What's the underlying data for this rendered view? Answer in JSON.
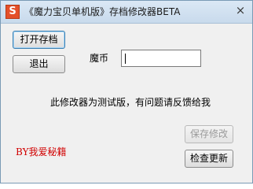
{
  "window": {
    "title": "《魔力宝贝单机版》存档修改器BETA",
    "icon_letter": "S",
    "close_glyph": "×"
  },
  "buttons": {
    "open_save": "打开存档",
    "exit": "退出",
    "save_changes": "保存修改",
    "check_update": "检查更新"
  },
  "form": {
    "coin_label": "魔币",
    "coin_value": ""
  },
  "info_text": "此修改器为测试版，有问题请反馈给我",
  "credit_text": "BY我爱秘籍",
  "colors": {
    "credit": "#d10000",
    "icon_bg": "#e4502a"
  }
}
